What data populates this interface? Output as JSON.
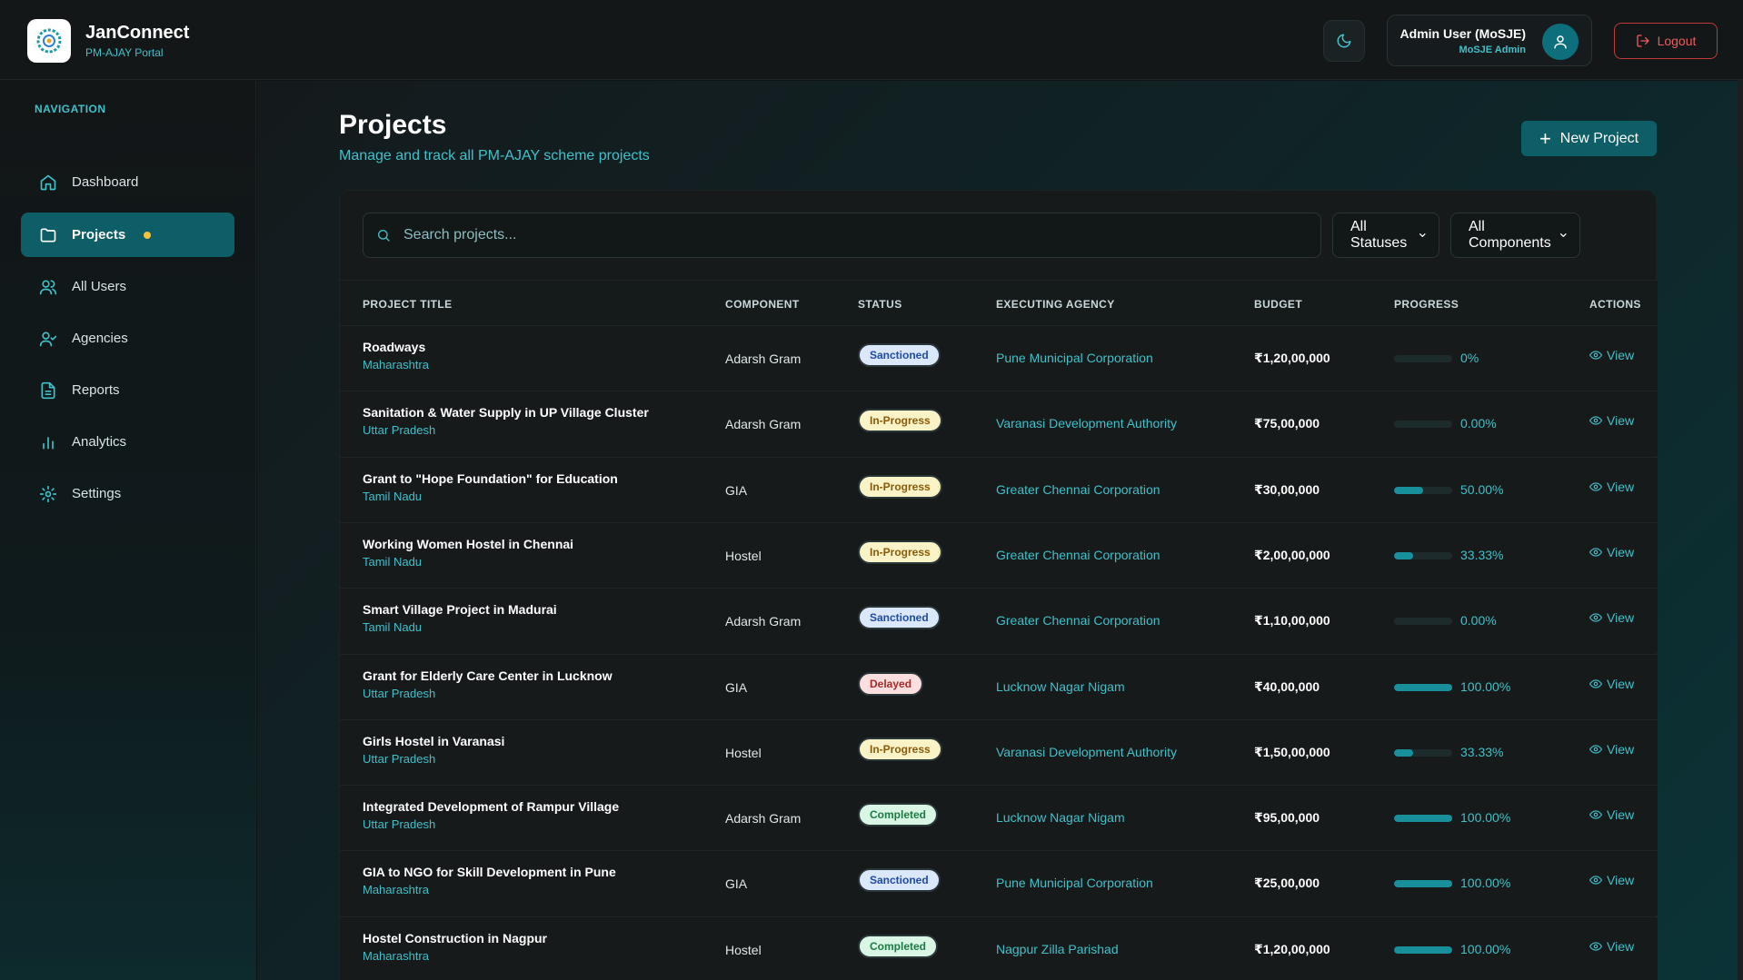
{
  "app": {
    "name": "JanConnect",
    "subtitle": "PM-AJAY Portal"
  },
  "user": {
    "name": "Admin User (MoSJE)",
    "role": "MoSJE Admin"
  },
  "header": {
    "logout_label": "Logout"
  },
  "sidebar": {
    "heading": "NAVIGATION",
    "items": [
      {
        "label": "Dashboard",
        "icon": "home-icon"
      },
      {
        "label": "Projects",
        "icon": "folder-icon",
        "active": true
      },
      {
        "label": "All Users",
        "icon": "users-icon"
      },
      {
        "label": "Agencies",
        "icon": "user-check-icon"
      },
      {
        "label": "Reports",
        "icon": "file-text-icon"
      },
      {
        "label": "Analytics",
        "icon": "bar-chart-icon"
      },
      {
        "label": "Settings",
        "icon": "gear-icon"
      }
    ]
  },
  "page": {
    "title": "Projects",
    "subtitle": "Manage and track all PM-AJAY scheme projects",
    "new_button": "New Project"
  },
  "filters": {
    "search_placeholder": "Search projects...",
    "status": "All Statuses",
    "component": "All Components"
  },
  "table": {
    "columns": [
      "PROJECT TITLE",
      "COMPONENT",
      "STATUS",
      "EXECUTING AGENCY",
      "BUDGET",
      "PROGRESS",
      "ACTIONS"
    ],
    "view_label": "View",
    "rows": [
      {
        "title": "Roadways",
        "state": "Maharashtra",
        "component": "Adarsh Gram",
        "status": "Sanctioned",
        "status_type": "sanctioned",
        "agency": "Pune Municipal Corporation",
        "budget": "₹1,20,00,000",
        "progress_label": "0%",
        "progress": 0
      },
      {
        "title": "Sanitation & Water Supply in UP Village Cluster",
        "state": "Uttar Pradesh",
        "component": "Adarsh Gram",
        "status": "In-Progress",
        "status_type": "progress",
        "agency": "Varanasi Development Authority",
        "budget": "₹75,00,000",
        "progress_label": "0.00%",
        "progress": 0
      },
      {
        "title": "Grant to \"Hope Foundation\" for Education",
        "state": "Tamil Nadu",
        "component": "GIA",
        "status": "In-Progress",
        "status_type": "progress",
        "agency": "Greater Chennai Corporation",
        "budget": "₹30,00,000",
        "progress_label": "50.00%",
        "progress": 50
      },
      {
        "title": "Working Women Hostel in Chennai",
        "state": "Tamil Nadu",
        "component": "Hostel",
        "status": "In-Progress",
        "status_type": "progress",
        "agency": "Greater Chennai Corporation",
        "budget": "₹2,00,00,000",
        "progress_label": "33.33%",
        "progress": 33.33
      },
      {
        "title": "Smart Village Project in Madurai",
        "state": "Tamil Nadu",
        "component": "Adarsh Gram",
        "status": "Sanctioned",
        "status_type": "sanctioned",
        "agency": "Greater Chennai Corporation",
        "budget": "₹1,10,00,000",
        "progress_label": "0.00%",
        "progress": 0
      },
      {
        "title": "Grant for Elderly Care Center in Lucknow",
        "state": "Uttar Pradesh",
        "component": "GIA",
        "status": "Delayed",
        "status_type": "delayed",
        "agency": "Lucknow Nagar Nigam",
        "budget": "₹40,00,000",
        "progress_label": "100.00%",
        "progress": 100
      },
      {
        "title": "Girls Hostel in Varanasi",
        "state": "Uttar Pradesh",
        "component": "Hostel",
        "status": "In-Progress",
        "status_type": "progress",
        "agency": "Varanasi Development Authority",
        "budget": "₹1,50,00,000",
        "progress_label": "33.33%",
        "progress": 33.33
      },
      {
        "title": "Integrated Development of Rampur Village",
        "state": "Uttar Pradesh",
        "component": "Adarsh Gram",
        "status": "Completed",
        "status_type": "completed",
        "agency": "Lucknow Nagar Nigam",
        "budget": "₹95,00,000",
        "progress_label": "100.00%",
        "progress": 100
      },
      {
        "title": "GIA to NGO for Skill Development in Pune",
        "state": "Maharashtra",
        "component": "GIA",
        "status": "Sanctioned",
        "status_type": "sanctioned",
        "agency": "Pune Municipal Corporation",
        "budget": "₹25,00,000",
        "progress_label": "100.00%",
        "progress": 100
      },
      {
        "title": "Hostel Construction in Nagpur",
        "state": "Maharashtra",
        "component": "Hostel",
        "status": "Completed",
        "status_type": "completed",
        "agency": "Nagpur Zilla Parishad",
        "budget": "₹1,20,00,000",
        "progress_label": "100.00%",
        "progress": 100
      }
    ]
  },
  "colors": {
    "accent": "#3fc1c9",
    "active_nav": "#0e5e68",
    "danger": "#ef5b5d",
    "notify_dot": "#f5c33b"
  }
}
